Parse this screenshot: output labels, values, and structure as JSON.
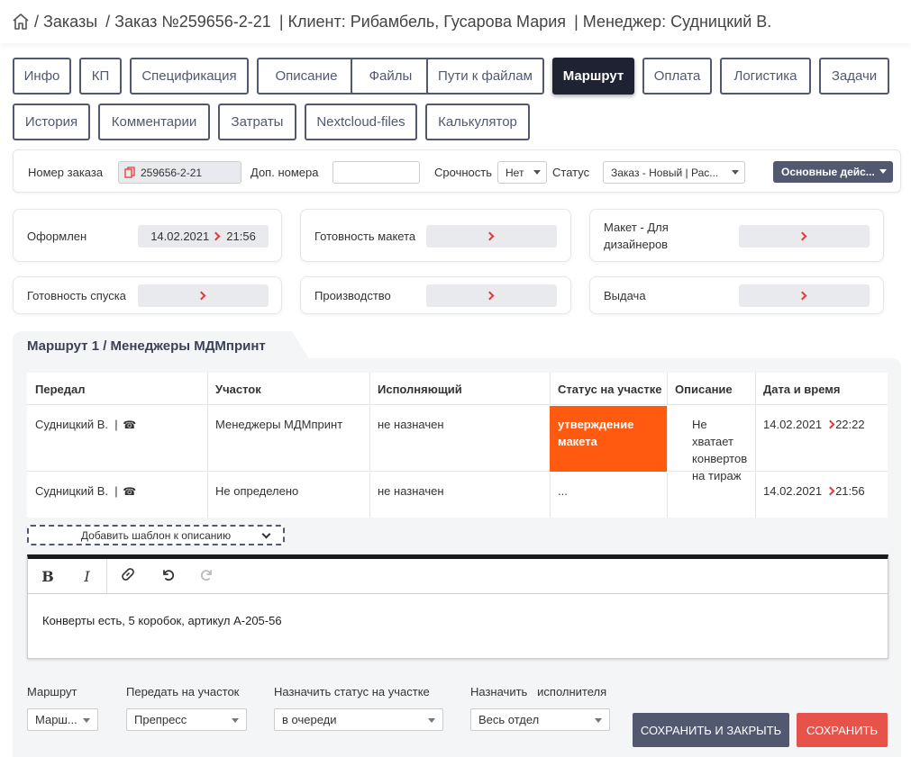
{
  "header": {
    "crumbs": [
      "/ Заказы",
      "/ Заказ №259656-2-21",
      "| Клиент: Рибамбель, Гусарова Мария",
      "| Менеджер: Судницкий В."
    ]
  },
  "tabs": [
    {
      "label": "Инфо",
      "active": false
    },
    {
      "label": "КП",
      "active": false
    },
    {
      "label": "Спецификация",
      "active": false
    },
    {
      "label": "Описание",
      "active": false
    },
    {
      "label": "Файлы",
      "active": false
    },
    {
      "label": "Пути к файлам",
      "active": false
    },
    {
      "label": "Маршрут",
      "active": true
    },
    {
      "label": "Оплата",
      "active": false
    },
    {
      "label": "Логистика",
      "active": false
    },
    {
      "label": "Задачи",
      "active": false
    },
    {
      "label": "История",
      "active": false
    },
    {
      "label": "Комментарии",
      "active": false
    },
    {
      "label": "Затраты",
      "active": false
    },
    {
      "label": "Nextcloud-files",
      "active": false
    },
    {
      "label": "Калькулятор",
      "active": false
    }
  ],
  "order": {
    "number_label": "Номер заказа",
    "number_value": "259656-2-21",
    "extra_label": "Доп. номера",
    "extra_value": "",
    "urgency_label": "Срочность",
    "urgency_value": "Нет",
    "status_label": "Статус",
    "status_value": "Заказ - Новый | Рас...",
    "actions_label": "Основные дейс..."
  },
  "stages": [
    {
      "label": "Оформлен",
      "date": "14.02.2021",
      "time": "21:56"
    },
    {
      "label": "Готовность макета",
      "date": "",
      "time": ""
    },
    {
      "label": "Макет - Для дизайнеров",
      "date": "",
      "time": ""
    },
    {
      "label": "Готовность спуска",
      "date": "",
      "time": ""
    },
    {
      "label": "Производство",
      "date": "",
      "time": ""
    },
    {
      "label": "Выдача",
      "date": "",
      "time": ""
    }
  ],
  "route": {
    "title": "Маршрут 1 / Менеджеры МДМпринт",
    "columns": [
      "Передал",
      "Участок",
      "Исполняющий",
      "Статус на участке",
      "Описание",
      "Дата и время"
    ],
    "rows": [
      {
        "from": "Судницкий В.",
        "sep": "|",
        "area": "Менеджеры МДМпринт",
        "executor": "не назначен",
        "status": "утверждение макета",
        "status_color": "#ff5a0f",
        "description": "Не хватает конвертов на тираж",
        "date": "14.02.2021",
        "time": "22:22"
      },
      {
        "from": "Судницкий В.",
        "sep": "|",
        "area": "Не определено",
        "executor": "не назначен",
        "status": "...",
        "status_color": "",
        "description": "",
        "date": "14.02.2021",
        "time": "21:56"
      }
    ]
  },
  "template_dropdown": "Добавить шаблон к описанию",
  "editor": {
    "bold": "B",
    "italic": "I",
    "text": "Конверты есть, 5 коробок, артикул А-205-56"
  },
  "form": {
    "route_label": "Маршрут",
    "route_value": "Марш...",
    "area_label": "Передать на участок",
    "area_value": "Препресс",
    "status_label": "Назначить статус на участке",
    "status_value": "в очереди",
    "executor_label": "Назначить   исполнителя",
    "executor_value": "Весь отдел"
  },
  "buttons": {
    "save_close": "СОХРАНИТЬ И ЗАКРЫТЬ",
    "save": "СОХРАНИТЬ"
  },
  "colors": {
    "accent": "#525870",
    "active_tab": "#1e2233",
    "status_orange": "#ff5a0f",
    "save_red": "#e5534b",
    "chevron_red": "#e53935"
  }
}
